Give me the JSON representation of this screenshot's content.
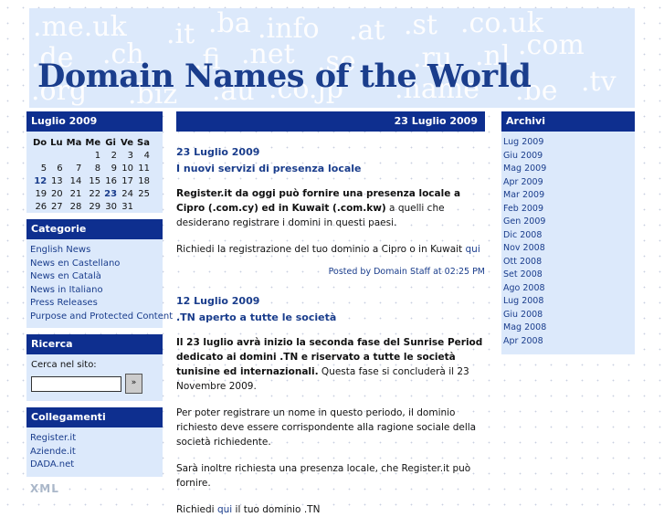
{
  "header": {
    "title": "Domain Names of the World",
    "tlds": [
      ".me.uk",
      ".it",
      ".ba",
      ".info",
      ".at",
      ".st",
      ".co.uk",
      ".de",
      ".ch",
      ".fi",
      ".net",
      ".se",
      ".ru",
      ".nl",
      ".com",
      ".org",
      ".biz",
      ".au",
      ".co.jp",
      ".name",
      ".be",
      ".tv"
    ]
  },
  "calendar": {
    "title": "Luglio 2009",
    "weekdays": [
      "Do",
      "Lu",
      "Ma",
      "Me",
      "Gi",
      "Ve",
      "Sa"
    ],
    "weeks": [
      [
        "",
        "",
        "",
        "1",
        "2",
        "3",
        "4"
      ],
      [
        "5",
        "6",
        "7",
        "8",
        "9",
        "10",
        "11"
      ],
      [
        "12",
        "13",
        "14",
        "15",
        "16",
        "17",
        "18"
      ],
      [
        "19",
        "20",
        "21",
        "22",
        "23",
        "24",
        "25"
      ],
      [
        "26",
        "27",
        "28",
        "29",
        "30",
        "31",
        ""
      ]
    ],
    "linked_days": [
      "12",
      "23"
    ]
  },
  "categories": {
    "title": "Categorie",
    "items": [
      "English News",
      "News en Castellano",
      "News en Català",
      "News in Italiano",
      "Press Releases",
      "Purpose and Protected Content"
    ]
  },
  "search": {
    "title": "Ricerca",
    "label": "Cerca nel sito:",
    "value": "",
    "button": "»"
  },
  "links": {
    "title": "Collegamenti",
    "items": [
      "Register.it",
      "Aziende.it",
      "DADA.net"
    ]
  },
  "bottom_logo": "XML",
  "main": {
    "date_header": "23 Luglio 2009",
    "posts": [
      {
        "date": "23 Luglio 2009",
        "title": "I nuovi servizi di presenza locale",
        "p1_bold": "Register.it da oggi può fornire una presenza locale a Cipro (.com.cy) ed in Kuwait (.com.kw)",
        "p1_rest": " a quelli che desiderano registrare i domini in questi paesi.",
        "p2_text": "Richiedi la registrazione del tuo dominio a Cipro o in Kuwait ",
        "p2_link": "qui",
        "footer": "Posted by Domain Staff at 02:25 PM"
      },
      {
        "date": "12 Luglio 2009",
        "title": ".TN aperto a tutte le società",
        "p1_bold": "Il 23 luglio avrà inizio la seconda fase del Sunrise Period dedicato ai domini .TN e riservato a tutte le società tunisine ed internazionali.",
        "p1_rest": " Questa fase si concluderà il 23 Novembre 2009.",
        "p2": "Per poter registrare un nome in questo periodo, il dominio richiesto deve essere corrispondente alla ragione sociale della società richiedente.",
        "p3": "Sarà inoltre richiesta una presenza locale, che Register.it può fornire.",
        "p4_pre": "Richiedi ",
        "p4_link": "qui",
        "p4_post": " il tuo dominio .TN"
      }
    ]
  },
  "archive": {
    "title": "Archivi",
    "items": [
      "Lug 2009",
      "Giu 2009",
      "Mag 2009",
      "Apr 2009",
      "Mar 2009",
      "Feb 2009",
      "Gen 2009",
      "Dic 2008",
      "Nov 2008",
      "Ott 2008",
      "Set 2008",
      "Ago 2008",
      "Lug 2008",
      "Giu 2008",
      "Mag 2008",
      "Apr 2008"
    ]
  },
  "colors": {
    "header_bar": "#0e2f8f",
    "panel_bg": "#dce9fb",
    "link": "#1a3d8c"
  }
}
